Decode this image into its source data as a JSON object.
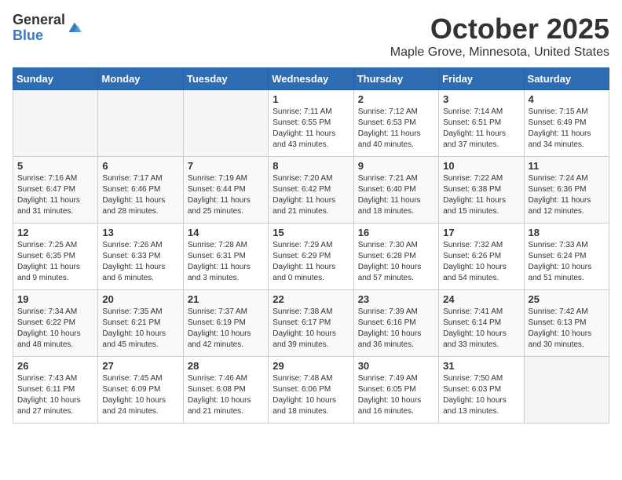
{
  "header": {
    "logo_general": "General",
    "logo_blue": "Blue",
    "month_title": "October 2025",
    "location": "Maple Grove, Minnesota, United States"
  },
  "weekdays": [
    "Sunday",
    "Monday",
    "Tuesday",
    "Wednesday",
    "Thursday",
    "Friday",
    "Saturday"
  ],
  "weeks": [
    [
      {
        "day": "",
        "sunrise": "",
        "sunset": "",
        "daylight": "",
        "empty": true
      },
      {
        "day": "",
        "sunrise": "",
        "sunset": "",
        "daylight": "",
        "empty": true
      },
      {
        "day": "",
        "sunrise": "",
        "sunset": "",
        "daylight": "",
        "empty": true
      },
      {
        "day": "1",
        "sunrise": "Sunrise: 7:11 AM",
        "sunset": "Sunset: 6:55 PM",
        "daylight": "Daylight: 11 hours and 43 minutes."
      },
      {
        "day": "2",
        "sunrise": "Sunrise: 7:12 AM",
        "sunset": "Sunset: 6:53 PM",
        "daylight": "Daylight: 11 hours and 40 minutes."
      },
      {
        "day": "3",
        "sunrise": "Sunrise: 7:14 AM",
        "sunset": "Sunset: 6:51 PM",
        "daylight": "Daylight: 11 hours and 37 minutes."
      },
      {
        "day": "4",
        "sunrise": "Sunrise: 7:15 AM",
        "sunset": "Sunset: 6:49 PM",
        "daylight": "Daylight: 11 hours and 34 minutes."
      }
    ],
    [
      {
        "day": "5",
        "sunrise": "Sunrise: 7:16 AM",
        "sunset": "Sunset: 6:47 PM",
        "daylight": "Daylight: 11 hours and 31 minutes."
      },
      {
        "day": "6",
        "sunrise": "Sunrise: 7:17 AM",
        "sunset": "Sunset: 6:46 PM",
        "daylight": "Daylight: 11 hours and 28 minutes."
      },
      {
        "day": "7",
        "sunrise": "Sunrise: 7:19 AM",
        "sunset": "Sunset: 6:44 PM",
        "daylight": "Daylight: 11 hours and 25 minutes."
      },
      {
        "day": "8",
        "sunrise": "Sunrise: 7:20 AM",
        "sunset": "Sunset: 6:42 PM",
        "daylight": "Daylight: 11 hours and 21 minutes."
      },
      {
        "day": "9",
        "sunrise": "Sunrise: 7:21 AM",
        "sunset": "Sunset: 6:40 PM",
        "daylight": "Daylight: 11 hours and 18 minutes."
      },
      {
        "day": "10",
        "sunrise": "Sunrise: 7:22 AM",
        "sunset": "Sunset: 6:38 PM",
        "daylight": "Daylight: 11 hours and 15 minutes."
      },
      {
        "day": "11",
        "sunrise": "Sunrise: 7:24 AM",
        "sunset": "Sunset: 6:36 PM",
        "daylight": "Daylight: 11 hours and 12 minutes."
      }
    ],
    [
      {
        "day": "12",
        "sunrise": "Sunrise: 7:25 AM",
        "sunset": "Sunset: 6:35 PM",
        "daylight": "Daylight: 11 hours and 9 minutes."
      },
      {
        "day": "13",
        "sunrise": "Sunrise: 7:26 AM",
        "sunset": "Sunset: 6:33 PM",
        "daylight": "Daylight: 11 hours and 6 minutes."
      },
      {
        "day": "14",
        "sunrise": "Sunrise: 7:28 AM",
        "sunset": "Sunset: 6:31 PM",
        "daylight": "Daylight: 11 hours and 3 minutes."
      },
      {
        "day": "15",
        "sunrise": "Sunrise: 7:29 AM",
        "sunset": "Sunset: 6:29 PM",
        "daylight": "Daylight: 11 hours and 0 minutes."
      },
      {
        "day": "16",
        "sunrise": "Sunrise: 7:30 AM",
        "sunset": "Sunset: 6:28 PM",
        "daylight": "Daylight: 10 hours and 57 minutes."
      },
      {
        "day": "17",
        "sunrise": "Sunrise: 7:32 AM",
        "sunset": "Sunset: 6:26 PM",
        "daylight": "Daylight: 10 hours and 54 minutes."
      },
      {
        "day": "18",
        "sunrise": "Sunrise: 7:33 AM",
        "sunset": "Sunset: 6:24 PM",
        "daylight": "Daylight: 10 hours and 51 minutes."
      }
    ],
    [
      {
        "day": "19",
        "sunrise": "Sunrise: 7:34 AM",
        "sunset": "Sunset: 6:22 PM",
        "daylight": "Daylight: 10 hours and 48 minutes."
      },
      {
        "day": "20",
        "sunrise": "Sunrise: 7:35 AM",
        "sunset": "Sunset: 6:21 PM",
        "daylight": "Daylight: 10 hours and 45 minutes."
      },
      {
        "day": "21",
        "sunrise": "Sunrise: 7:37 AM",
        "sunset": "Sunset: 6:19 PM",
        "daylight": "Daylight: 10 hours and 42 minutes."
      },
      {
        "day": "22",
        "sunrise": "Sunrise: 7:38 AM",
        "sunset": "Sunset: 6:17 PM",
        "daylight": "Daylight: 10 hours and 39 minutes."
      },
      {
        "day": "23",
        "sunrise": "Sunrise: 7:39 AM",
        "sunset": "Sunset: 6:16 PM",
        "daylight": "Daylight: 10 hours and 36 minutes."
      },
      {
        "day": "24",
        "sunrise": "Sunrise: 7:41 AM",
        "sunset": "Sunset: 6:14 PM",
        "daylight": "Daylight: 10 hours and 33 minutes."
      },
      {
        "day": "25",
        "sunrise": "Sunrise: 7:42 AM",
        "sunset": "Sunset: 6:13 PM",
        "daylight": "Daylight: 10 hours and 30 minutes."
      }
    ],
    [
      {
        "day": "26",
        "sunrise": "Sunrise: 7:43 AM",
        "sunset": "Sunset: 6:11 PM",
        "daylight": "Daylight: 10 hours and 27 minutes."
      },
      {
        "day": "27",
        "sunrise": "Sunrise: 7:45 AM",
        "sunset": "Sunset: 6:09 PM",
        "daylight": "Daylight: 10 hours and 24 minutes."
      },
      {
        "day": "28",
        "sunrise": "Sunrise: 7:46 AM",
        "sunset": "Sunset: 6:08 PM",
        "daylight": "Daylight: 10 hours and 21 minutes."
      },
      {
        "day": "29",
        "sunrise": "Sunrise: 7:48 AM",
        "sunset": "Sunset: 6:06 PM",
        "daylight": "Daylight: 10 hours and 18 minutes."
      },
      {
        "day": "30",
        "sunrise": "Sunrise: 7:49 AM",
        "sunset": "Sunset: 6:05 PM",
        "daylight": "Daylight: 10 hours and 16 minutes."
      },
      {
        "day": "31",
        "sunrise": "Sunrise: 7:50 AM",
        "sunset": "Sunset: 6:03 PM",
        "daylight": "Daylight: 10 hours and 13 minutes."
      },
      {
        "day": "",
        "sunrise": "",
        "sunset": "",
        "daylight": "",
        "empty": true
      }
    ]
  ]
}
